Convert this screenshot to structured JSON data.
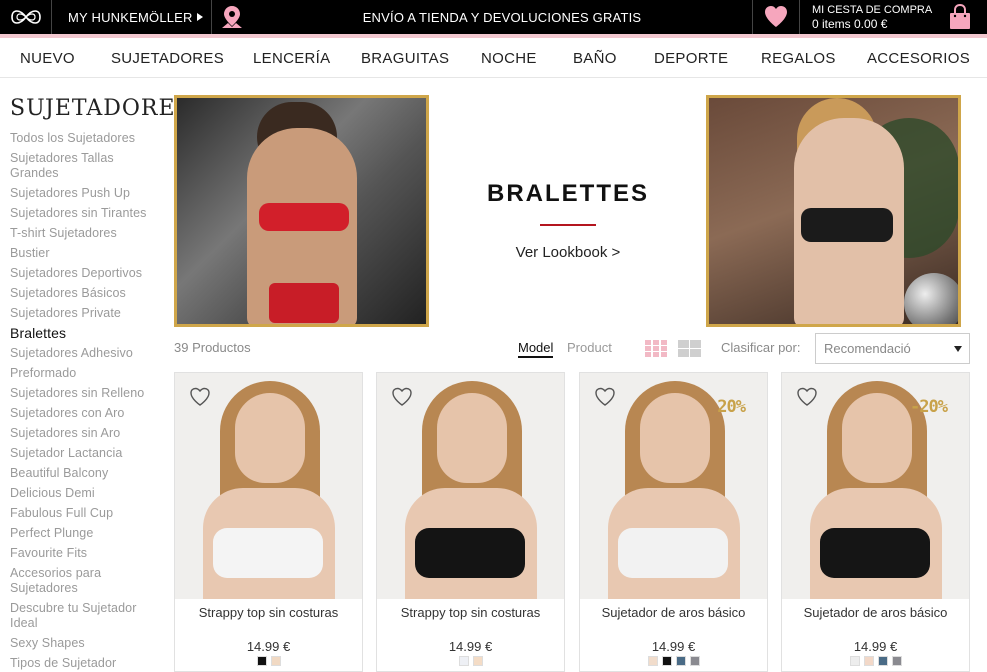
{
  "topbar": {
    "account_label": "MY HUNKEMÖLLER",
    "promo": "ENVÍO A TIENDA Y DEVOLUCIONES GRATIS",
    "cart_title": "MI CESTA DE COMPRA",
    "cart_summary": "0 items 0.00 €"
  },
  "nav": {
    "items": [
      {
        "label": "NUEVO"
      },
      {
        "label": "SUJETADORES"
      },
      {
        "label": "LENCERÍA"
      },
      {
        "label": "BRAGUITAS"
      },
      {
        "label": "NOCHE"
      },
      {
        "label": "BAÑO"
      },
      {
        "label": "DEPORTE"
      },
      {
        "label": "REGALOS"
      },
      {
        "label": "ACCESORIOS"
      }
    ]
  },
  "sidebar": {
    "title": "SUJETADORES",
    "items": [
      {
        "label": "Todos los Sujetadores"
      },
      {
        "label": "Sujetadores Tallas Grandes"
      },
      {
        "label": "Sujetadores Push Up"
      },
      {
        "label": "Sujetadores sin Tirantes"
      },
      {
        "label": "T-shirt Sujetadores"
      },
      {
        "label": "Bustier"
      },
      {
        "label": "Sujetadores Deportivos"
      },
      {
        "label": "Sujetadores Básicos"
      },
      {
        "label": "Sujetadores Private"
      },
      {
        "label": "Bralettes"
      },
      {
        "label": "Sujetadores Adhesivo"
      },
      {
        "label": "Preformado"
      },
      {
        "label": "Sujetadores sin Relleno"
      },
      {
        "label": "Sujetadores con Aro"
      },
      {
        "label": "Sujetadores sin Aro"
      },
      {
        "label": "Sujetador Lactancia"
      },
      {
        "label": "Beautiful Balcony"
      },
      {
        "label": "Delicious Demi"
      },
      {
        "label": "Fabulous Full Cup"
      },
      {
        "label": "Perfect Plunge"
      },
      {
        "label": "Favourite Fits"
      },
      {
        "label": "Accesorios para Sujetadores"
      },
      {
        "label": "Descubre tu Sujetador Ideal"
      },
      {
        "label": "Sexy Shapes"
      },
      {
        "label": "Tipos de Sujetador"
      }
    ],
    "active": "Bralettes"
  },
  "banner": {
    "title": "BRALETTES",
    "link": "Ver Lookbook >"
  },
  "toolbar": {
    "count": "39 Productos",
    "view_model": "Model",
    "view_product": "Product",
    "sort_label": "Clasificar por:",
    "sort_value": "Recomendació"
  },
  "products": [
    {
      "name": "Strappy top sin costuras",
      "price": "14.99 €",
      "badge": "",
      "bra_color": "#f4f4f4",
      "swatches": [
        "#111111",
        "#f1d9c3"
      ]
    },
    {
      "name": "Strappy top sin costuras",
      "price": "14.99 €",
      "badge": "",
      "bra_color": "#141414",
      "swatches": [
        "#eef0f5",
        "#f4dcc6"
      ]
    },
    {
      "name": "Sujetador de aros básico",
      "price": "14.99 €",
      "badge": "20%",
      "bra_color": "#f2f2f2",
      "swatches": [
        "#f1dccb",
        "#111111",
        "#4a6b86",
        "#8a8a90"
      ]
    },
    {
      "name": "Sujetador de aros básico",
      "price": "14.99 €",
      "badge": "-20%",
      "bra_color": "#151515",
      "swatches": [
        "#ededed",
        "#f2d8c8",
        "#4a6b86",
        "#8a8a90"
      ]
    }
  ],
  "colors": {
    "accent_red": "#b4151f",
    "gold_frame": "#cfa64a",
    "pink_line": "#f2c7cf",
    "pink_heart": "#f6a6bd"
  }
}
